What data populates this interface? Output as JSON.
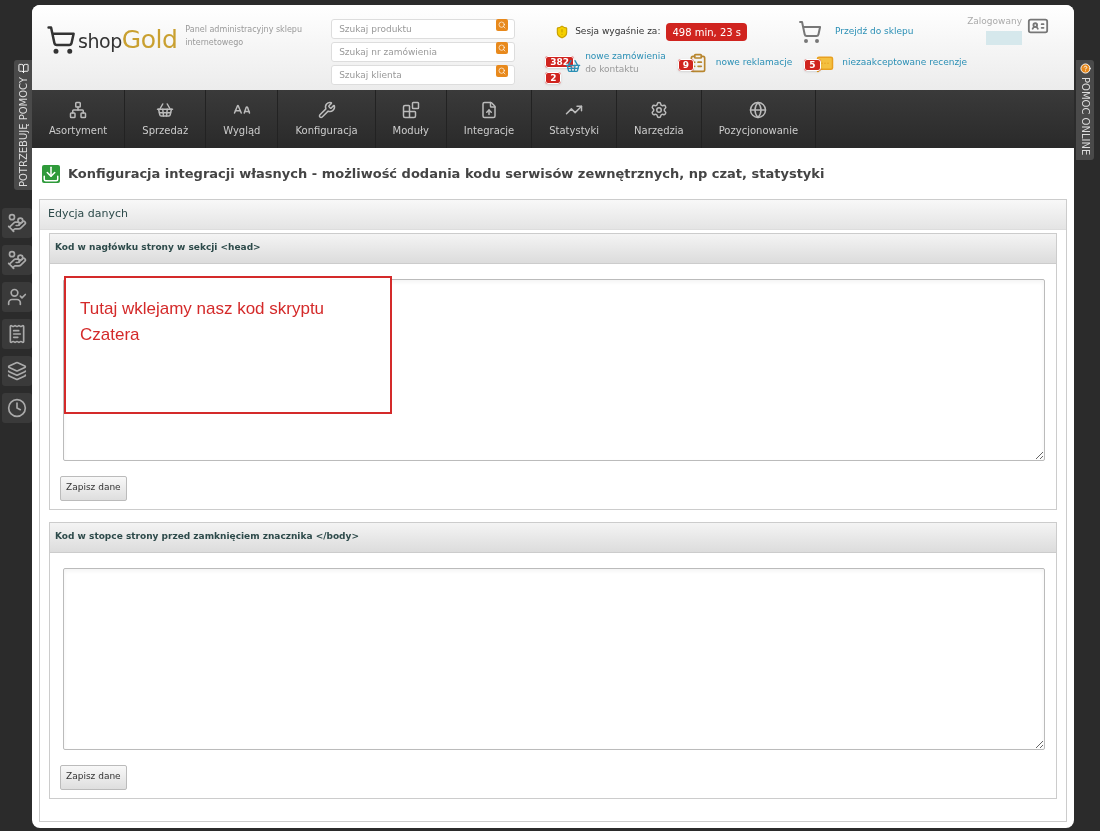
{
  "logo": {
    "prefix": "shop",
    "brand": "Gold"
  },
  "tagline": "Panel administracyjny sklepu internetowego",
  "searches": [
    {
      "placeholder": "Szukaj produktu"
    },
    {
      "placeholder": "Szukaj nr zamówienia"
    },
    {
      "placeholder": "Szukaj klienta"
    }
  ],
  "session": {
    "label": "Sesja wygaśnie za:",
    "value": "498 min, 23 s"
  },
  "shop_link": "Przejdź do sklepu",
  "user": {
    "label": "Zalogowany"
  },
  "notifications": [
    {
      "kind": "orders",
      "count": "382",
      "label": "nowe zamówienia",
      "sub_count": "2",
      "sub_label": "do kontaktu"
    },
    {
      "kind": "complaints",
      "count": "9",
      "label": "nowe reklamacje"
    },
    {
      "kind": "reviews",
      "count": "5",
      "label": "niezaakceptowane recenzje"
    }
  ],
  "nav": [
    {
      "label": "Asortyment"
    },
    {
      "label": "Sprzedaż"
    },
    {
      "label": "Wygląd"
    },
    {
      "label": "Konfiguracja"
    },
    {
      "label": "Moduły"
    },
    {
      "label": "Integracje"
    },
    {
      "label": "Statystyki"
    },
    {
      "label": "Narzędzia"
    },
    {
      "label": "Pozycjonowanie"
    }
  ],
  "help_tab": "POTRZEBUJĘ POMOCY",
  "online_tab": "POMOC ONLINE",
  "page_title": "Konfiguracja integracji własnych - możliwość dodania kodu serwisów zewnętrznych, np czat, statystyki",
  "panel": {
    "title": "Edycja danych",
    "sections": [
      {
        "title": "Kod w nagłówku strony w sekcji <head>",
        "button": "Zapisz dane"
      },
      {
        "title": "Kod w stopce strony przed zamknięciem znacznika </body>",
        "button": "Zapisz dane"
      }
    ]
  },
  "annotation": "Tutaj wklejamy nasz kod skryptu Czatera"
}
